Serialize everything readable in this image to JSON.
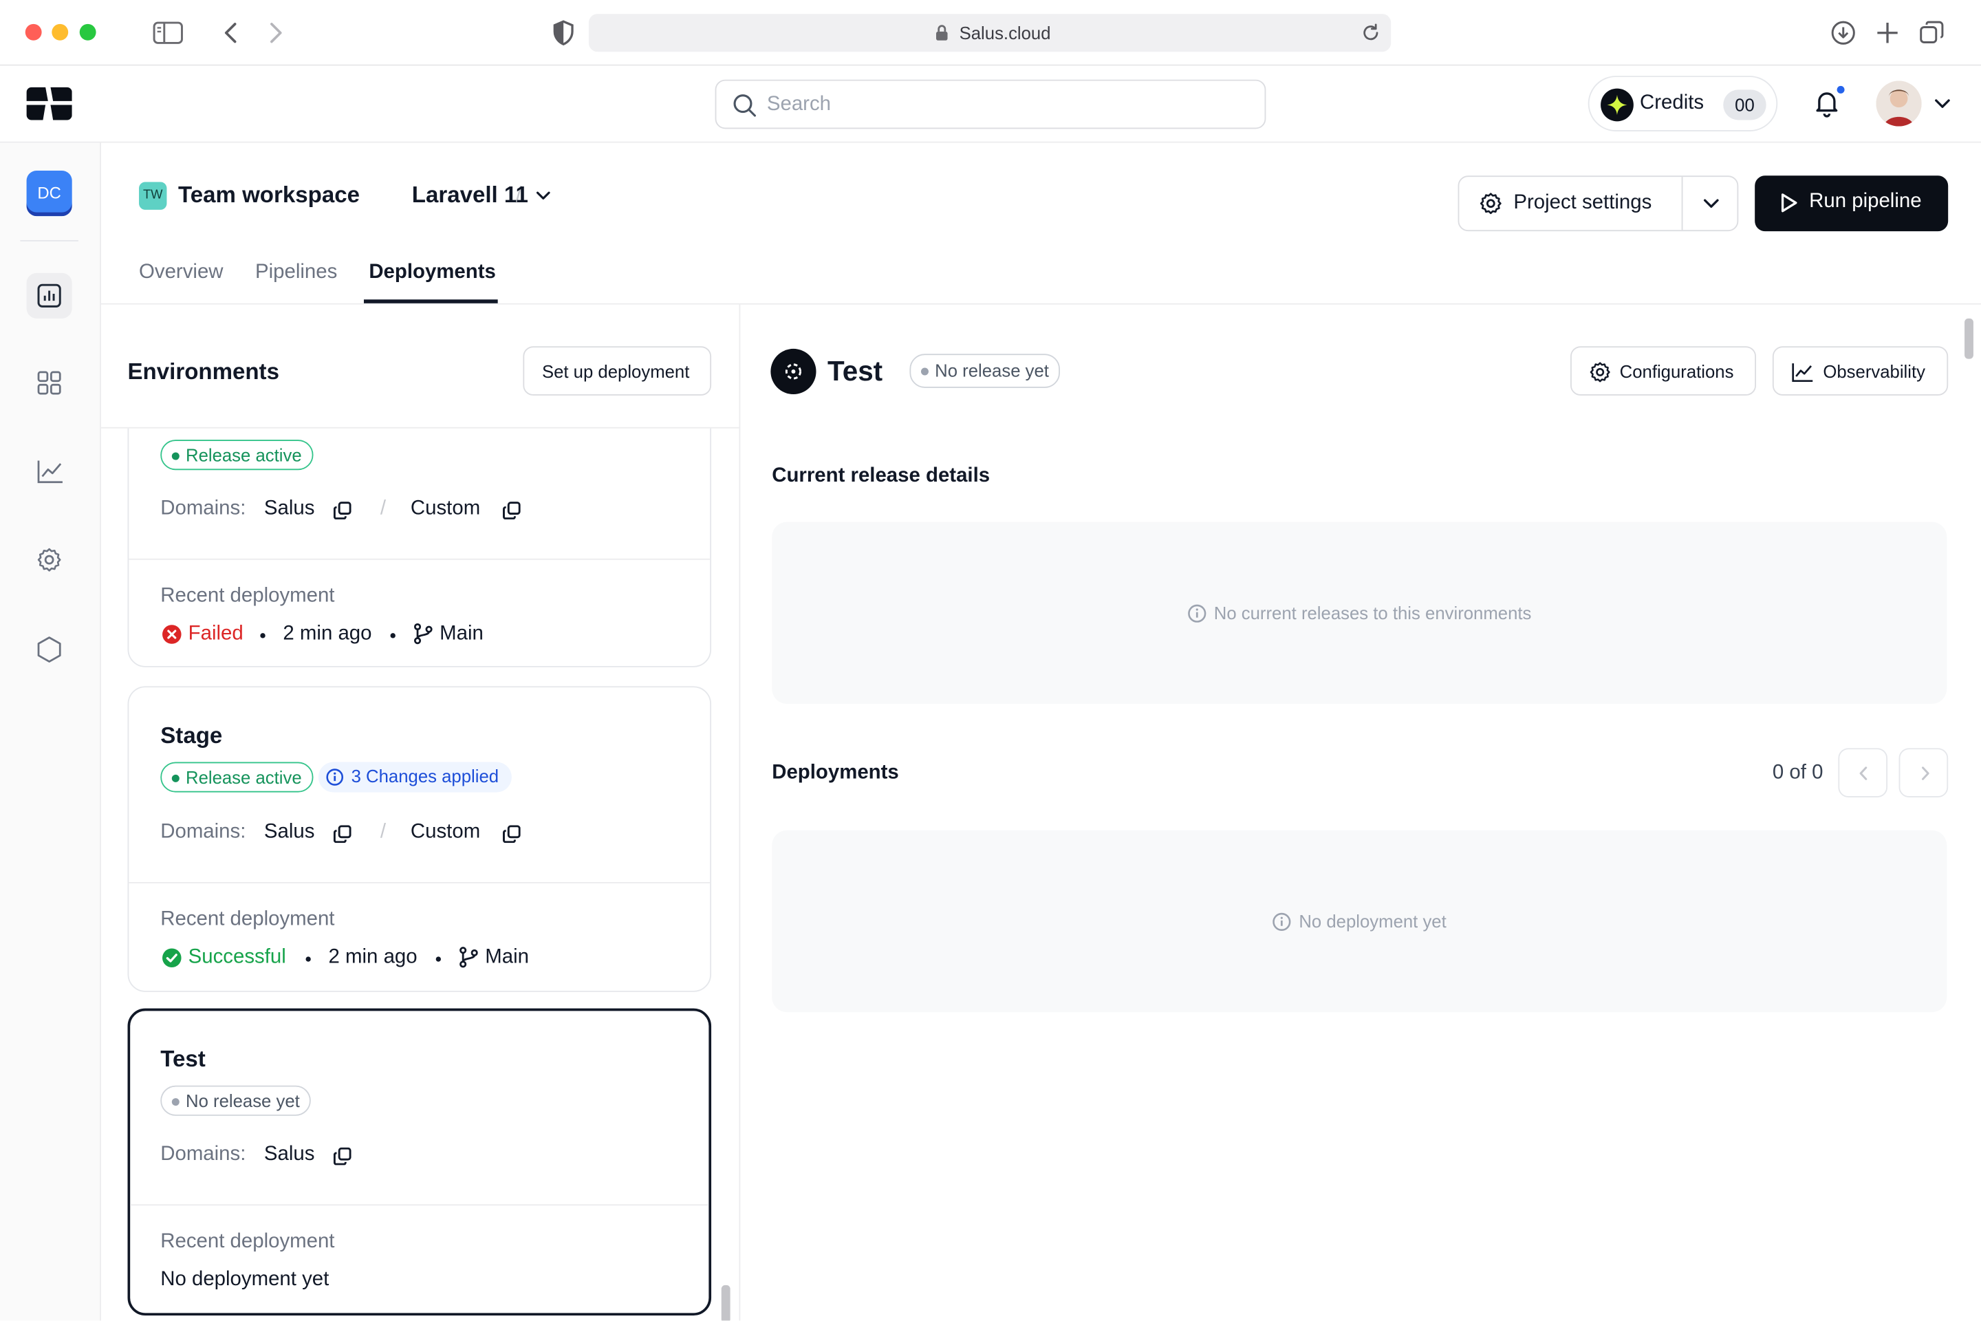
{
  "browser": {
    "url": "Salus.cloud"
  },
  "header": {
    "search_placeholder": "Search",
    "credits_label": "Credits",
    "credits_count": "00"
  },
  "sidebar": {
    "workspace_initials": "DC"
  },
  "breadcrumb": {
    "workspace_initials": "TW",
    "workspace": "Team workspace",
    "project": "Laravell 11"
  },
  "actions": {
    "project_settings": "Project settings",
    "run_pipeline": "Run pipeline"
  },
  "tabs": [
    {
      "label": "Overview"
    },
    {
      "label": "Pipelines"
    },
    {
      "label": "Deployments"
    }
  ],
  "environments": {
    "title": "Environments",
    "setup_button": "Set up deployment",
    "domains_label": "Domains:",
    "recent_label": "Recent deployment",
    "cards": [
      {
        "status": "Release active",
        "domains": [
          "Salus",
          "Custom"
        ],
        "deploy_status": "Failed",
        "deploy_time": "2 min ago",
        "branch": "Main"
      },
      {
        "name": "Stage",
        "status": "Release active",
        "changes": "3 Changes applied",
        "domains": [
          "Salus",
          "Custom"
        ],
        "deploy_status": "Successful",
        "deploy_time": "2 min ago",
        "branch": "Main"
      },
      {
        "name": "Test",
        "status": "No release yet",
        "domains": [
          "Salus"
        ],
        "deploy_text": "No deployment yet"
      }
    ]
  },
  "detail": {
    "name": "Test",
    "status": "No release yet",
    "configurations": "Configurations",
    "observability": "Observability",
    "current_release_title": "Current release details",
    "current_release_empty": "No current releases to this environments",
    "deployments_title": "Deployments",
    "pager": "0 of 0",
    "deployments_empty": "No deployment yet"
  },
  "colors": {
    "accent_dark": "#0b0f17",
    "success": "#16a34a",
    "danger": "#dc2626",
    "info": "#1d4ed8"
  }
}
